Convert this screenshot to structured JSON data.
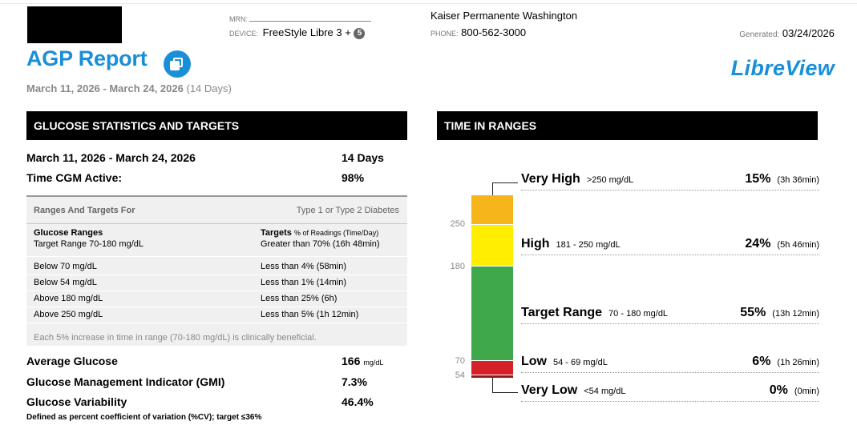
{
  "header": {
    "mrn_label": "MRN:",
    "device_label": "DEVICE:",
    "device_value": "FreeStyle Libre 3 +",
    "device_badge": "5",
    "organization": "Kaiser Permanente Washington",
    "phone_label": "PHONE:",
    "phone_value": "800-562-3000",
    "generated_label": "Generated:",
    "generated_value": "03/24/2026"
  },
  "report": {
    "title": "AGP Report",
    "copy_icon": "copy-icon",
    "brand": "LibreView",
    "date_range": "March 11, 2026 - March 24, 2026",
    "days": "(14 Days)"
  },
  "stats": {
    "heading": "GLUCOSE STATISTICS AND TARGETS",
    "period_label": "March 11, 2026 - March 24, 2026",
    "period_value": "14 Days",
    "cgm_label": "Time CGM Active:",
    "cgm_value": "98%",
    "ranges_header_left": "Ranges And Targets For",
    "ranges_header_right": "Type 1 or Type 2 Diabetes",
    "col1_title": "Glucose Ranges",
    "col1_sub": "Target Range 70-180 mg/dL",
    "col2_title": "Targets",
    "col2_title_small": "% of Readings (Time/Day)",
    "col2_sub": "Greater than 70% (16h 48min)",
    "rows": [
      {
        "range": "Below 70 mg/dL",
        "target": "Less than 4% (58min)"
      },
      {
        "range": "Below 54 mg/dL",
        "target": "Less than 1% (14min)"
      },
      {
        "range": "Above 180 mg/dL",
        "target": "Less than 25% (6h)"
      },
      {
        "range": "Above 250 mg/dL",
        "target": "Less than 5% (1h 12min)"
      }
    ],
    "note": "Each 5% increase in time in range (70-180 mg/dL) is clinically beneficial.",
    "avg_label": "Average Glucose",
    "avg_value": "166",
    "avg_unit": "mg/dL",
    "gmi_label": "Glucose Management Indicator (GMI)",
    "gmi_value": "7.3%",
    "var_label": "Glucose Variability",
    "var_value": "46.4%",
    "var_note": "Defined as percent coefficient of variation (%CV); target ≤36%"
  },
  "tir": {
    "heading": "TIME IN RANGES",
    "axis_labels": [
      "250",
      "180",
      "70",
      "54"
    ],
    "colors": {
      "very_high": "#f5b51b",
      "high": "#ffee00",
      "target": "#3ea84a",
      "low": "#d62027",
      "very_low": "#8b1a1a"
    },
    "rows": [
      {
        "name": "Very High",
        "range": ">250 mg/dL",
        "pct": "15%",
        "dur": "(3h 36min)",
        "fraction": 0.15
      },
      {
        "name": "High",
        "range": "181 - 250 mg/dL",
        "pct": "24%",
        "dur": "(5h 46min)",
        "fraction": 0.24
      },
      {
        "name": "Target Range",
        "range": "70 - 180 mg/dL",
        "pct": "55%",
        "dur": "(13h 12min)",
        "fraction": 0.55
      },
      {
        "name": "Low",
        "range": "54 - 69 mg/dL",
        "pct": "6%",
        "dur": "(1h 26min)",
        "fraction": 0.06
      },
      {
        "name": "Very Low",
        "range": "<54 mg/dL",
        "pct": "0%",
        "dur": "(0min)",
        "fraction": 0.0
      }
    ]
  }
}
